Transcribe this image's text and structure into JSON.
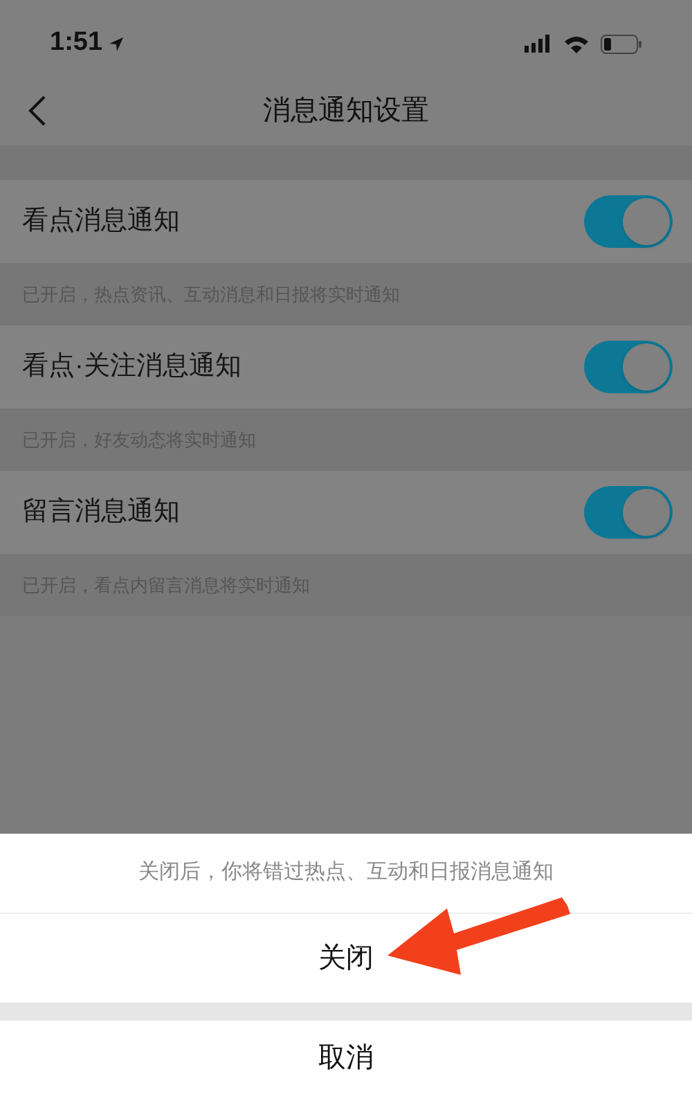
{
  "status_bar": {
    "time": "1:51"
  },
  "nav": {
    "title": "消息通知设置"
  },
  "settings": [
    {
      "label": "看点消息通知",
      "on": true,
      "description": "已开启，热点资讯、互动消息和日报将实时通知"
    },
    {
      "label": "看点·关注消息通知",
      "on": true,
      "description": "已开启，好友动态将实时通知"
    },
    {
      "label": "留言消息通知",
      "on": true,
      "description": "已开启，看点内留言消息将实时通知"
    }
  ],
  "action_sheet": {
    "message": "关闭后，你将错过热点、互动和日报消息通知",
    "actions": [
      {
        "label": "关闭",
        "kind": "action"
      },
      {
        "label": "取消",
        "kind": "cancel"
      }
    ]
  }
}
